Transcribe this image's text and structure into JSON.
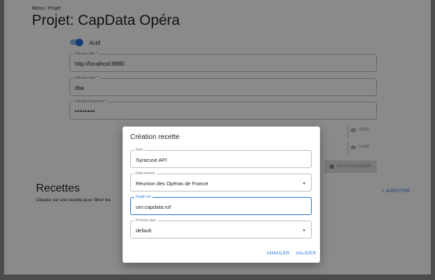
{
  "breadcrumb": "Menu / Projet",
  "page_title": "Projet: CapData Opéra",
  "toggle": {
    "label": "Actif",
    "state": "on",
    "color": "#1e6fd9"
  },
  "fields": {
    "url": {
      "label": "Virtuoso URL *",
      "value": "http://localhost:8890"
    },
    "user": {
      "label": "Virtuoso User *",
      "value": "dba"
    },
    "password": {
      "label": "Virtuoso Password *",
      "value": "••••••••"
    }
  },
  "voir_label": "VOIR",
  "save_label": "SAUVEGARDER",
  "recettes": {
    "title": "Recettes",
    "subtitle": "Cliquez sur une recette pour filtrer les",
    "add_label": "+ AJOUTER"
  },
  "dialog": {
    "title": "Création recette",
    "fields": {
      "nom": {
        "label": "Nom",
        "value": "Syracuse API"
      },
      "data_service": {
        "label": "Data service",
        "value": "Réunion des Opéras de France"
      },
      "graph_uri": {
        "label": "Graph Uri",
        "value": "urn:capdata:rof"
      },
      "process_type": {
        "label": "Process type",
        "value": "default"
      }
    },
    "cancel_label": "ANNULER",
    "validate_label": "VALIDER"
  }
}
